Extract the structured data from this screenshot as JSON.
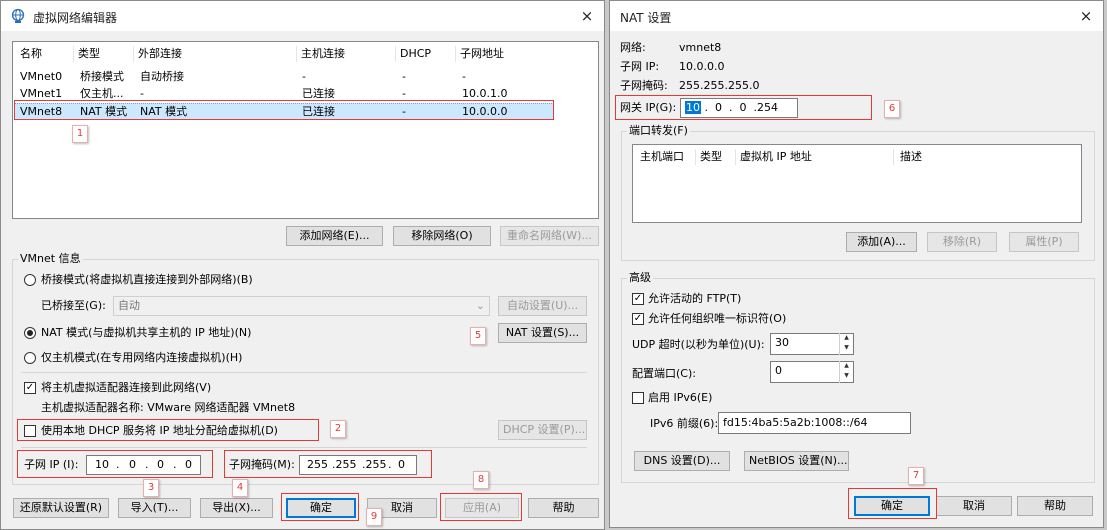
{
  "left": {
    "title": "虚拟网络编辑器",
    "close": "×",
    "table": {
      "headers": [
        "名称",
        "类型",
        "外部连接",
        "主机连接",
        "DHCP",
        "子网地址"
      ],
      "rows": [
        [
          "VMnet0",
          "桥接模式",
          "自动桥接",
          "-",
          "-",
          "-"
        ],
        [
          "VMnet1",
          "仅主机...",
          "-",
          "已连接",
          "-",
          "10.0.1.0"
        ],
        [
          "VMnet8",
          "NAT 模式",
          "NAT 模式",
          "已连接",
          "-",
          "10.0.0.0"
        ]
      ],
      "selected_row": 2
    },
    "btn_add_network": "添加网络(E)...",
    "btn_remove_network": "移除网络(O)",
    "btn_rename_network": "重命名网络(W)...",
    "vmnet_info": "VMnet 信息",
    "radio_bridge": "桥接模式(将虚拟机直接连接到外部网络)(B)",
    "bridged_to_label": "已桥接至(G):",
    "bridged_to_value": "自动",
    "btn_auto_settings": "自动设置(U)...",
    "radio_nat": "NAT 模式(与虚拟机共享主机的 IP 地址)(N)",
    "btn_nat_settings": "NAT 设置(S)...",
    "radio_host_only": "仅主机模式(在专用网络内连接虚拟机)(H)",
    "chk_connect_adapter": "将主机虚拟适配器连接到此网络(V)",
    "adapter_name_label": "主机虚拟适配器名称: VMware 网络适配器 VMnet8",
    "chk_dhcp": "使用本地 DHCP 服务将 IP 地址分配给虚拟机(D)",
    "btn_dhcp_settings": "DHCP 设置(P)...",
    "subnet_ip_label": "子网 IP (I):",
    "subnet_ip": [
      "10",
      ".",
      "0",
      ".",
      "0",
      ".",
      "0"
    ],
    "subnet_mask_label": "子网掩码(M):",
    "subnet_mask": [
      "255",
      ".255",
      ".255",
      ".",
      "0"
    ],
    "btn_restore": "还原默认设置(R)",
    "btn_import": "导入(T)...",
    "btn_export": "导出(X)...",
    "btn_ok": "确定",
    "btn_cancel": "取消",
    "btn_apply": "应用(A)",
    "btn_help": "帮助"
  },
  "right": {
    "title": "NAT 设置",
    "close": "×",
    "network_label": "网络:",
    "network_value": "vmnet8",
    "subnet_ip_label": "子网 IP:",
    "subnet_ip_value": "10.0.0.0",
    "subnet_mask_label": "子网掩码:",
    "subnet_mask_value": "255.255.255.0",
    "gateway_label": "网关 IP(G):",
    "gateway_first": "10",
    "gateway_rest": " .  0  .  0  .254",
    "port_forward_label": "端口转发(F)",
    "pf_headers": [
      "主机端口",
      "类型",
      "虚拟机 IP 地址",
      "描述"
    ],
    "btn_pf_add": "添加(A)...",
    "btn_pf_remove": "移除(R)",
    "btn_pf_props": "属性(P)",
    "advanced_label": "高级",
    "chk_ftp": "允许活动的 FTP(T)",
    "chk_oui": "允许任何组织唯一标识符(O)",
    "udp_label": "UDP 超时(以秒为单位)(U):",
    "udp_value": "30",
    "config_port_label": "配置端口(C):",
    "config_port_value": "0",
    "chk_ipv6": "启用 IPv6(E)",
    "ipv6_prefix_label": "IPv6 前缀(6):",
    "ipv6_prefix_value": "fd15:4ba5:5a2b:1008::/64",
    "btn_dns": "DNS 设置(D)...",
    "btn_netbios": "NetBIOS 设置(N)...",
    "btn_ok": "确定",
    "btn_cancel": "取消",
    "btn_help": "帮助"
  },
  "badges": [
    "1",
    "2",
    "3",
    "4",
    "5",
    "6",
    "7",
    "8",
    "9"
  ],
  "colors": {
    "accent": "#0078d7",
    "annotation": "#e53935",
    "window_bg": "#f0f0f0"
  }
}
